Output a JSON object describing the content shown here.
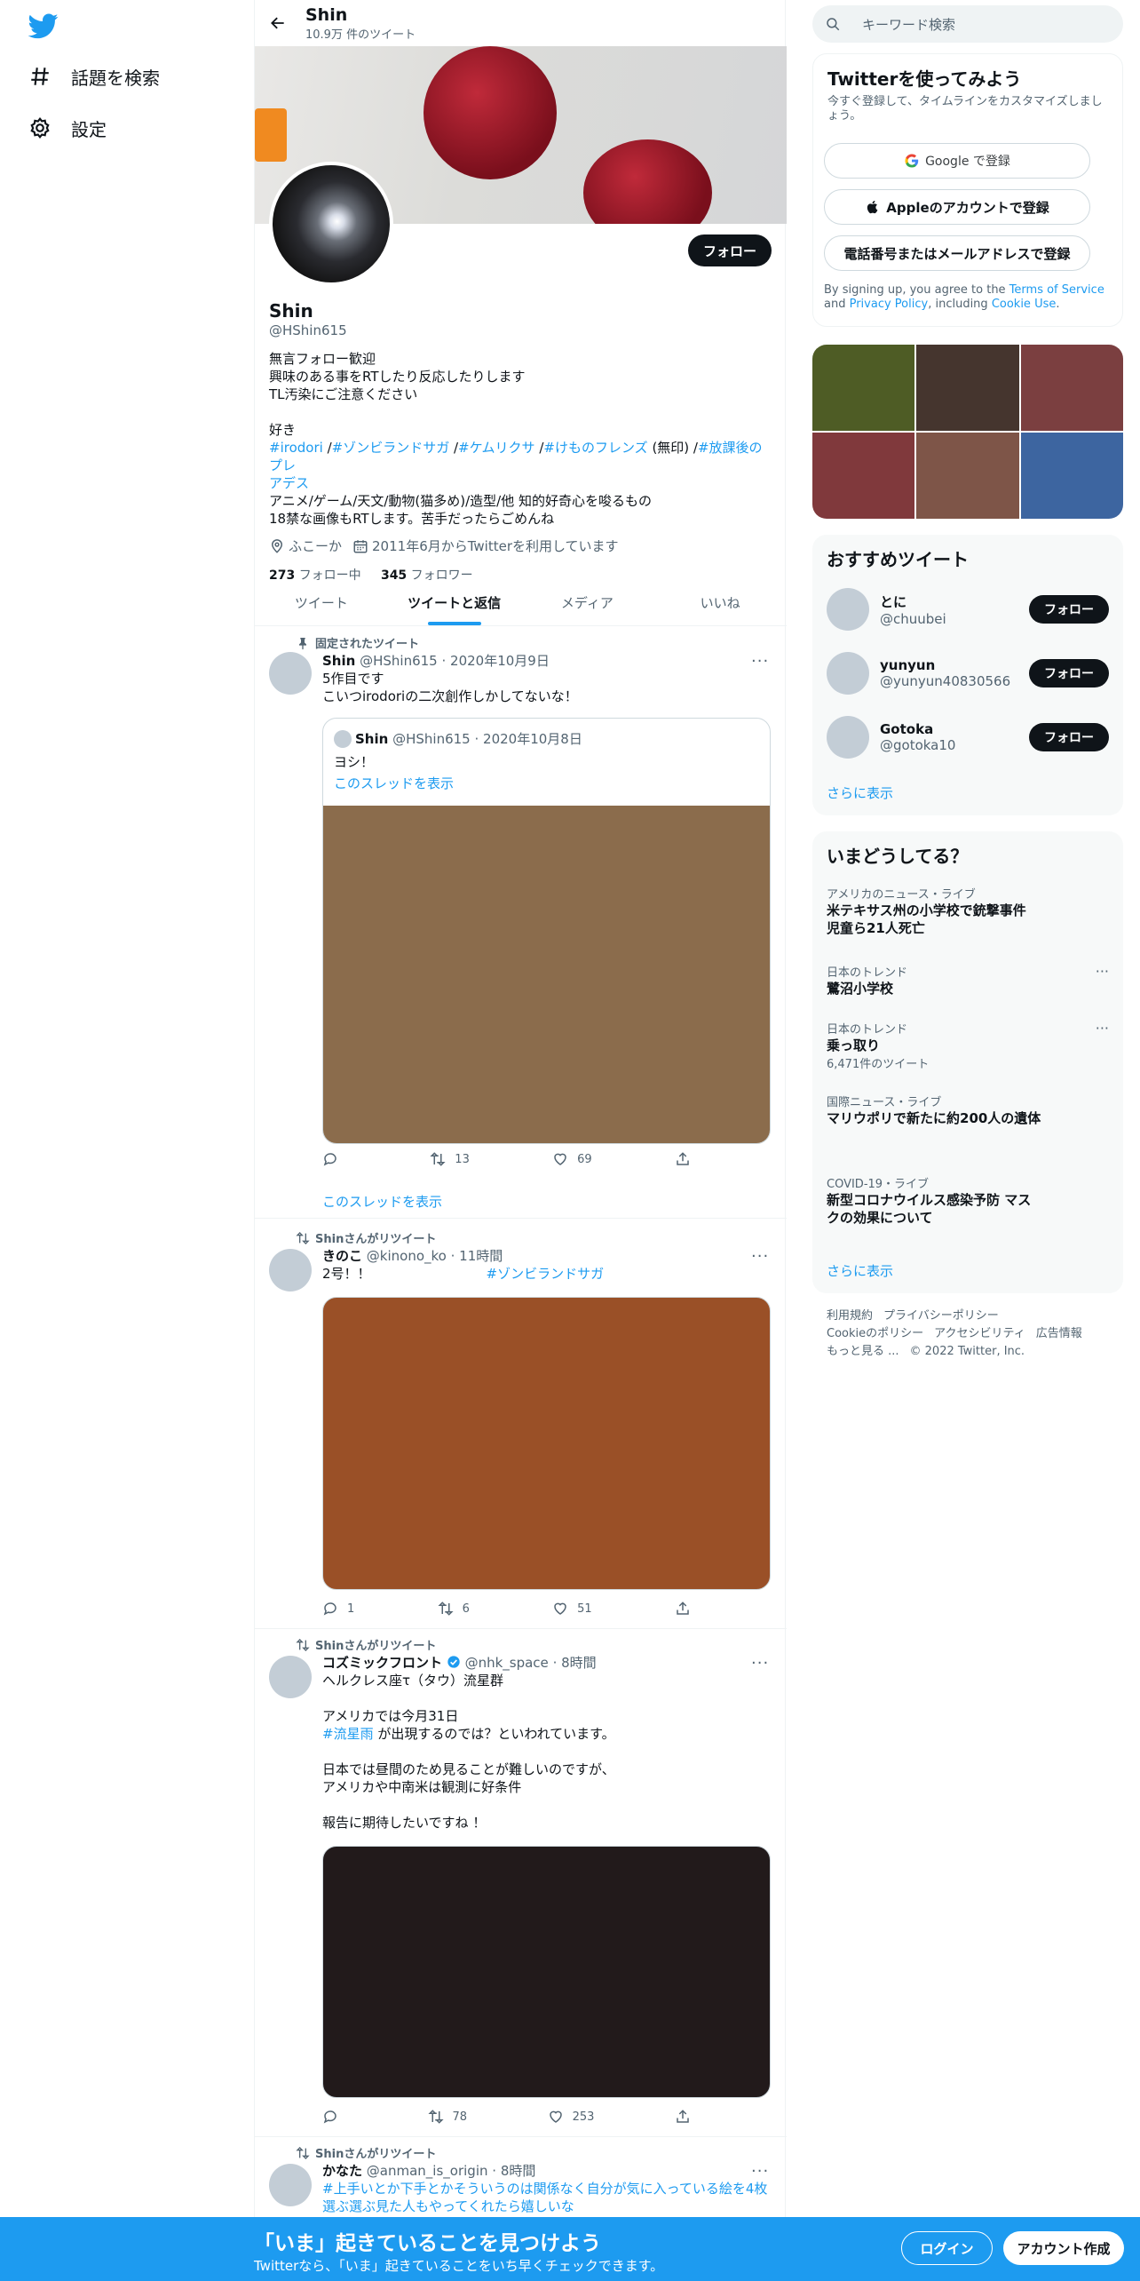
{
  "nav": {
    "explore": "話題を検索",
    "settings": "設定"
  },
  "profile": {
    "header_name": "Shin",
    "tweet_count": "10.9万 件のツイート",
    "follow_button": "フォロー",
    "name": "Shin",
    "handle": "@HShin615",
    "bio_lines": [
      "無言フォロー歓迎",
      "興味のある事をRTしたり反応したりします",
      "TL汚染にご注意ください",
      "",
      "好き"
    ],
    "bio_tags_line1": [
      "#irodori",
      " /",
      "#ゾンビランドサガ",
      " /",
      "#ケムリクサ",
      " /",
      "#けものフレンズ",
      " (無印) /",
      "#放課後のプレ"
    ],
    "bio_tags_line2": "アデス",
    "bio_after": [
      "アニメ/ゲーム/天文/動物(猫多め)/造型/他 知的好奇心を唆るもの",
      "18禁な画像もRTします。苦手だったらごめんね"
    ],
    "location": "ふこーか",
    "joined": "2011年6月からTwitterを利用しています",
    "following_count": "273",
    "following_label": "フォロー中",
    "followers_count": "345",
    "followers_label": "フォロワー"
  },
  "tabs": [
    "ツイート",
    "ツイートと返信",
    "メディア",
    "いいね"
  ],
  "tweets": [
    {
      "context": "固定されたツイート",
      "name": "Shin",
      "handle": "@HShin615",
      "date": "· 2020年10月9日",
      "lines": [
        "5作目です",
        "こいつirodoriの二次創作しかしてないな！"
      ],
      "quote": {
        "name": "Shin",
        "handle": "@HShin615",
        "date": "· 2020年10月8日",
        "text": "ヨシ！",
        "thread": "このスレッドを表示",
        "media_color": "#8b6c4c"
      },
      "replies": "",
      "retweets": "13",
      "likes": "69",
      "show_thread": "このスレッドを表示"
    },
    {
      "context": "Shinさんがリツイート",
      "name": "きのこ",
      "handle": "@kinono_ko",
      "date": "· 11時間",
      "text": "2号！！",
      "hashtag": "#ゾンビランドサガ",
      "media_color": "#9a5027",
      "replies": "1",
      "retweets": "6",
      "likes": "51"
    },
    {
      "context": "Shinさんがリツイート",
      "name": "コズミックフロント",
      "handle": "@nhk_space",
      "date": "· 8時間",
      "lines": [
        "ヘルクレス座τ（タウ）流星群",
        "",
        "アメリカでは今月31日"
      ],
      "tag_line_tag": "#流星雨",
      "tag_line_rest": " が出現するのでは？といわれています。",
      "lines2": [
        "",
        "日本では昼間のため見ることが難しいのですが、",
        "アメリカや中南米は観測に好条件",
        "",
        "報告に期待したいですね ！"
      ],
      "media_color": "#221a1b",
      "replies": "",
      "retweets": "78",
      "likes": "253"
    },
    {
      "context": "Shinさんがリツイート",
      "name": "かなた",
      "handle": "@anman_is_origin",
      "date": "· 8時間",
      "text": "#上手いとか下手とかそういうのは関係なく自分が気に入っている絵を4枚選ぶ選ぶ見た人もやってくれたら嬉しいな"
    }
  ],
  "right": {
    "search_placeholder": "キーワード検索",
    "signup_title": "Twitterを使ってみよう",
    "signup_sub": "今すぐ登録して、タイムラインをカスタマイズしましょう。",
    "google": "Google で登録",
    "apple": "Appleのアカウントで登録",
    "phone": "電話番号またはメールアドレスで登録",
    "terms_1": "By signing up, you agree to the ",
    "terms_tos": "Terms of Service",
    "terms_2": " and ",
    "terms_privacy": "Privacy Policy",
    "terms_3": ", including ",
    "terms_cookie": "Cookie Use",
    "terms_4": ".",
    "photo_colors": [
      "#4e5c25",
      "#45352e",
      "#7b3f40",
      "#80393c",
      "#7e5548",
      "#3d65a0"
    ],
    "recommended_title": "おすすめツイート",
    "recommended": [
      {
        "name": "とに",
        "handle": "@chuubei",
        "button": "フォロー"
      },
      {
        "name": "yunyun",
        "handle": "@yunyun40830566",
        "button": "フォロー"
      },
      {
        "name": "Gotoka",
        "handle": "@gotoka10",
        "button": "フォロー"
      }
    ],
    "show_more": "さらに表示",
    "trends_title": "いまどうしてる？",
    "trends": [
      {
        "context": "アメリカのニュース・ライブ",
        "title1": "米テキサス州の小学校で銃撃事件",
        "title2": "児童ら21人死亡",
        "count": ""
      },
      {
        "context": "日本のトレンド",
        "title1": "鷺沼小学校",
        "title2": "",
        "count": ""
      },
      {
        "context": "日本のトレンド",
        "title1": "乗っ取り",
        "title2": "",
        "count": "6,471件のツイート"
      },
      {
        "context": "国際ニュース・ライブ",
        "title1": "マリウポリで新たに約200人の遺体",
        "title2": "",
        "count": ""
      },
      {
        "context": "COVID-19・ライブ",
        "title1": "新型コロナウイルス感染予防 マス",
        "title2": "クの効果について",
        "count": ""
      }
    ],
    "trends_more": "さらに表示",
    "footer": [
      "利用規約",
      "プライバシーポリシー",
      "Cookieのポリシー",
      "アクセシビリティ",
      "広告情報",
      "もっと見る ...",
      "© 2022 Twitter, Inc."
    ]
  },
  "bottom": {
    "headline": "「いま」起きていることを見つけよう",
    "sub": "Twitterなら、「いま」起きていることをいち早くチェックできます。",
    "login": "ログイン",
    "signup": "アカウント作成"
  }
}
